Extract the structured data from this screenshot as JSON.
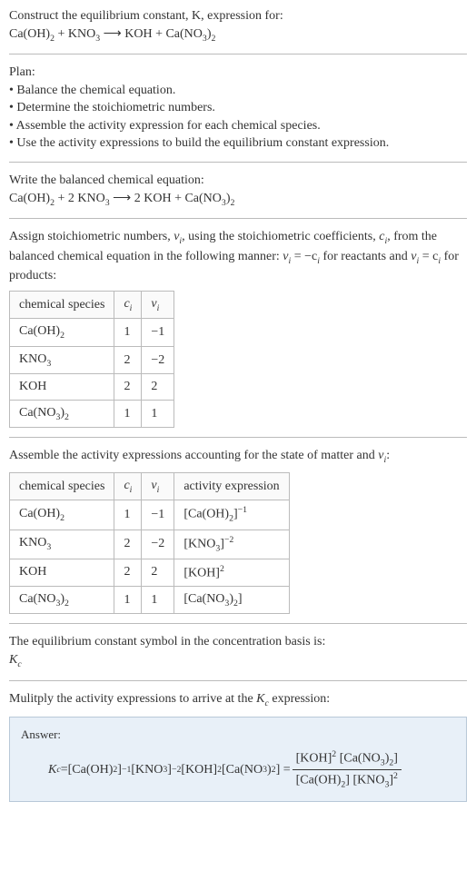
{
  "prompt": {
    "line1": "Construct the equilibrium constant, K, expression for:",
    "eq_lhs1": "Ca(OH)",
    "eq_lhs1_sub": "2",
    "plus1": " + KNO",
    "eq_lhs2_sub": "3",
    "arrow": " ⟶ ",
    "rhs1": "KOH + Ca(NO",
    "rhs1_sub": "3",
    "rhs_close": ")",
    "rhs2_sub": "2"
  },
  "plan": {
    "heading": "Plan:",
    "b1": "• Balance the chemical equation.",
    "b2": "• Determine the stoichiometric numbers.",
    "b3": "• Assemble the activity expression for each chemical species.",
    "b4": "• Use the activity expressions to build the equilibrium constant expression."
  },
  "balanced": {
    "intro": "Write the balanced chemical equation:",
    "lhs1": "Ca(OH)",
    "lhs1_sub": "2",
    "plus1": " + 2 KNO",
    "lhs2_sub": "3",
    "arrow": " ⟶ ",
    "rhs1": "2 KOH + Ca(NO",
    "rhs1_sub": "3",
    "rhs_close": ")",
    "rhs2_sub": "2"
  },
  "assign": {
    "text1": "Assign stoichiometric numbers, ",
    "text2": ", using the stoichiometric coefficients, ",
    "text3": ", from the balanced chemical equation in the following manner: ",
    "text4": " for reactants and ",
    "text5": " for products:",
    "nu": "ν",
    "nu_i": "i",
    "c": "c",
    "c_i": "i",
    "rel1a": "ν",
    "rel1b": "i",
    "rel1c": " = −c",
    "rel1d": "i",
    "rel2a": "ν",
    "rel2b": "i",
    "rel2c": " = c",
    "rel2d": "i"
  },
  "table1": {
    "h1": "chemical species",
    "h2": "c",
    "h2sub": "i",
    "h3": "ν",
    "h3sub": "i",
    "r1c1a": "Ca(OH)",
    "r1c1b": "2",
    "r1c2": "1",
    "r1c3": "−1",
    "r2c1a": "KNO",
    "r2c1b": "3",
    "r2c2": "2",
    "r2c3": "−2",
    "r3c1": "KOH",
    "r3c2": "2",
    "r3c3": "2",
    "r4c1a": "Ca(NO",
    "r4c1b": "3",
    "r4c1c": ")",
    "r4c1d": "2",
    "r4c2": "1",
    "r4c3": "1"
  },
  "assemble": {
    "text1": "Assemble the activity expressions accounting for the state of matter and ",
    "nu": "ν",
    "nu_i": "i",
    "text2": ":"
  },
  "table2": {
    "h1": "chemical species",
    "h2": "c",
    "h2sub": "i",
    "h3": "ν",
    "h3sub": "i",
    "h4": "activity expression",
    "r1c1a": "Ca(OH)",
    "r1c1b": "2",
    "r1c2": "1",
    "r1c3": "−1",
    "r1c4a": "[Ca(OH)",
    "r1c4b": "2",
    "r1c4c": "]",
    "r1c4d": "−1",
    "r2c1a": "KNO",
    "r2c1b": "3",
    "r2c2": "2",
    "r2c3": "−2",
    "r2c4a": "[KNO",
    "r2c4b": "3",
    "r2c4c": "]",
    "r2c4d": "−2",
    "r3c1": "KOH",
    "r3c2": "2",
    "r3c3": "2",
    "r3c4a": "[KOH]",
    "r3c4b": "2",
    "r4c1a": "Ca(NO",
    "r4c1b": "3",
    "r4c1c": ")",
    "r4c1d": "2",
    "r4c2": "1",
    "r4c3": "1",
    "r4c4a": "[Ca(NO",
    "r4c4b": "3",
    "r4c4c": ")",
    "r4c4d": "2",
    "r4c4e": "]"
  },
  "symbol": {
    "text": "The equilibrium constant symbol in the concentration basis is:",
    "K": "K",
    "Ksub": "c"
  },
  "mult": {
    "text1": "Mulitply the activity expressions to arrive at the ",
    "K": "K",
    "Ksub": "c",
    "text2": " expression:"
  },
  "answer": {
    "label": "Answer:",
    "K": "K",
    "Ksub": "c",
    "eq": " = ",
    "t1a": "[Ca(OH)",
    "t1b": "2",
    "t1c": "]",
    "t1d": "−1",
    "t2a": " [KNO",
    "t2b": "3",
    "t2c": "]",
    "t2d": "−2",
    "t3a": " [KOH]",
    "t3b": "2",
    "t4a": " [Ca(NO",
    "t4b": "3",
    "t4c": ")",
    "t4d": "2",
    "t4e": "] = ",
    "numA": "[KOH]",
    "numAexp": "2",
    "numB": " [Ca(NO",
    "numBsub": "3",
    "numBc": ")",
    "numBd": "2",
    "numBe": "]",
    "denA": "[Ca(OH)",
    "denAsub": "2",
    "denAc": "] ",
    "denB": "[KNO",
    "denBsub": "3",
    "denBc": "]",
    "denBexp": "2"
  },
  "chart_data": {
    "type": "table",
    "tables": [
      {
        "columns": [
          "chemical species",
          "c_i",
          "ν_i"
        ],
        "rows": [
          [
            "Ca(OH)2",
            1,
            -1
          ],
          [
            "KNO3",
            2,
            -2
          ],
          [
            "KOH",
            2,
            2
          ],
          [
            "Ca(NO3)2",
            1,
            1
          ]
        ]
      },
      {
        "columns": [
          "chemical species",
          "c_i",
          "ν_i",
          "activity expression"
        ],
        "rows": [
          [
            "Ca(OH)2",
            1,
            -1,
            "[Ca(OH)2]^-1"
          ],
          [
            "KNO3",
            2,
            -2,
            "[KNO3]^-2"
          ],
          [
            "KOH",
            2,
            2,
            "[KOH]^2"
          ],
          [
            "Ca(NO3)2",
            1,
            1,
            "[Ca(NO3)2]"
          ]
        ]
      }
    ]
  }
}
